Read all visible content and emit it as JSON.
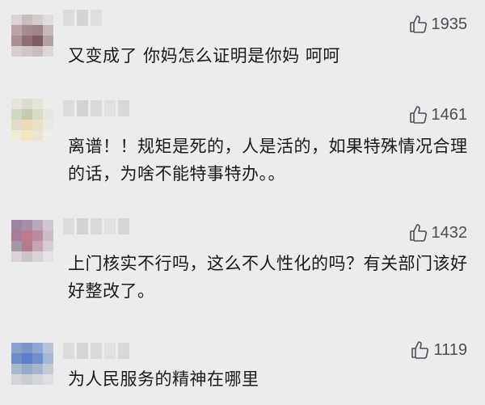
{
  "colors": {
    "background": "#ececec",
    "text": "#1a1a1a",
    "like": "#4a4f56"
  },
  "comments": [
    {
      "likes": "1935",
      "text": "又变成了 你妈怎么证明是你妈 呵呵",
      "like_icon": "thumbs-up-icon"
    },
    {
      "likes": "1461",
      "text": "离谱！！规矩是死的，人是活的，如果特殊情况合理的话，为啥不能特事特办。。",
      "like_icon": "thumbs-up-icon"
    },
    {
      "likes": "1432",
      "text": "上门核实不行吗，这么不人性化的吗？有关部门该好好整改了。",
      "like_icon": "thumbs-up-icon"
    },
    {
      "likes": "1119",
      "text": "为人民服务的精神在哪里",
      "like_icon": "thumbs-up-icon"
    }
  ]
}
